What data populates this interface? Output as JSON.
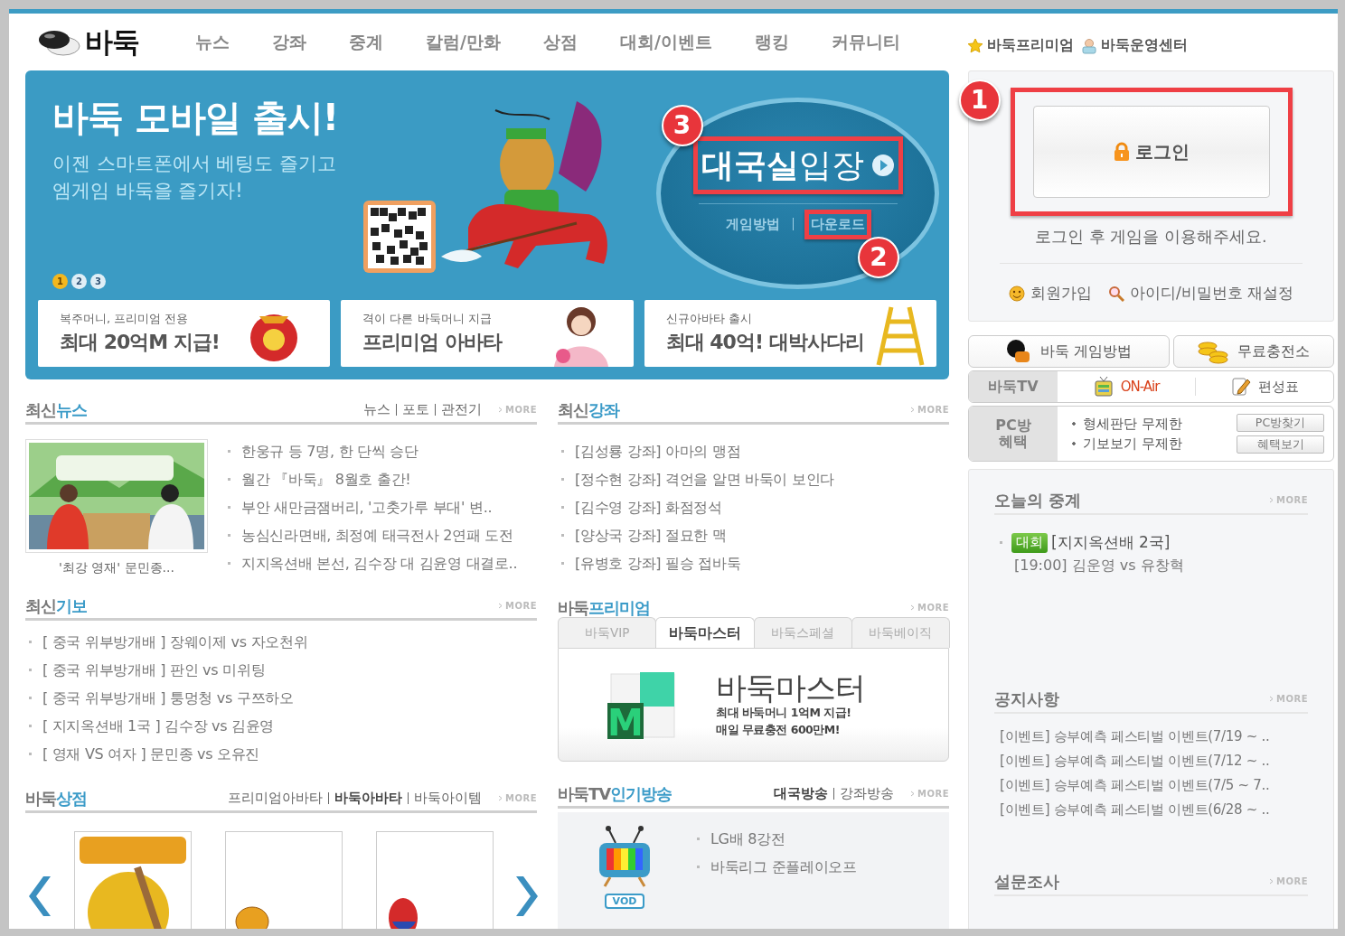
{
  "header": {
    "logo": "바둑",
    "nav": [
      {
        "label": "뉴스"
      },
      {
        "label": "강좌"
      },
      {
        "label": "중계"
      },
      {
        "label": "칼럼/만화"
      },
      {
        "label": "상점"
      },
      {
        "label": "대회/이벤트"
      },
      {
        "label": "랭킹"
      },
      {
        "label": "커뮤니티"
      }
    ],
    "links": [
      {
        "label": "바둑프리미엄"
      },
      {
        "label": "바둑운영센터"
      }
    ]
  },
  "banner": {
    "title": "바둑 모바일 출시!",
    "subtitle": [
      "이젠 스마트폰에서 베팅도 즐기고",
      "엠게임 바둑을 즐기자!"
    ],
    "pager": [
      {
        "label": "1",
        "selected": true
      },
      {
        "label": "2",
        "selected": false
      },
      {
        "label": "3",
        "selected": false
      }
    ],
    "enter": {
      "label": "**대국실**입장",
      "callout": "3"
    },
    "links": [
      {
        "label": "게임방법"
      },
      {
        "label": "다운로드",
        "callout": "2"
      }
    ],
    "promos": [
      {
        "caption": "복주머니, 프리미엄 전용",
        "headline": "최대 20억M 지급!"
      },
      {
        "caption": "격이 다른 바둑머니 지급",
        "headline": "프리미엄 아바타"
      },
      {
        "caption": "신규아바타 출시",
        "headline": "최대 40억! 대박사다리"
      }
    ]
  },
  "news": {
    "heading": {
      "title": "최신",
      "accent": "뉴스"
    },
    "sublinks": [
      {
        "label": "뉴스",
        "selected": false
      },
      {
        "label": "포토",
        "selected": false
      },
      {
        "label": "관전기",
        "selected": false
      }
    ],
    "more": "MORE",
    "photo_caption": "'최강 영재' 문민종...",
    "items": [
      "한웅규 등 7명, 한 단씩 승단",
      "월간 『바둑』 8월호 출간!",
      "부안 새만금잼버리, '고춧가루 부대' 변..",
      "농심신라면배, 최정예 태극전사 2연패 도전",
      "지지옥션배 본선, 김수장 대 김윤영 대결로.."
    ]
  },
  "lectures": {
    "heading": {
      "title": "최신",
      "accent": "강좌"
    },
    "more": "MORE",
    "items": [
      "[김성룡 강좌] 아마의 맹점",
      "[정수현 강좌] 격언을 알면 바둑이 보인다",
      "[김수영 강좌] 화점정석",
      "[양상국 강좌] 절묘한 맥",
      "[유병호 강좌] 필승 접바둑"
    ]
  },
  "records": {
    "heading": {
      "title": "최신",
      "accent": "기보"
    },
    "more": "MORE",
    "items": [
      "[ 중국 위부방개배 ] 장웨이제 vs 자오천위",
      "[ 중국 위부방개배 ] 판인 vs 미위팅",
      "[ 중국 위부방개배 ] 퉁멍청 vs 구쯔하오",
      "[ 지지옥션배 1국 ] 김수장 vs 김윤영",
      "[ 영재 VS 여자 ] 문민종 vs 오유진"
    ]
  },
  "premium": {
    "heading": {
      "title": "바둑",
      "accent": "프리미엄"
    },
    "more": "MORE",
    "tabs": [
      {
        "label": "바둑VIP",
        "selected": false
      },
      {
        "label": "바둑마스터",
        "selected": true
      },
      {
        "label": "바둑스페셜",
        "selected": false
      },
      {
        "label": "바둑베이직",
        "selected": false
      }
    ],
    "logo_letter": "M",
    "title": "바둑마스터",
    "lines": [
      "최대 바둑머니 1억M 지급!",
      "매일 무료충전 600만M!"
    ]
  },
  "shop": {
    "heading": {
      "title": "바둑",
      "accent": "상점"
    },
    "sublinks": [
      {
        "label": "프리미엄아바타",
        "selected": false
      },
      {
        "label": "바둑아바타",
        "selected": true
      },
      {
        "label": "바둑아이템",
        "selected": false
      }
    ],
    "more": "MORE"
  },
  "tv": {
    "heading": {
      "title": "바둑TV",
      "accent": "인기방송"
    },
    "sublinks": [
      {
        "label": "대국방송",
        "selected": true
      },
      {
        "label": "강좌방송",
        "selected": false
      }
    ],
    "more": "MORE",
    "badge": "VOD",
    "items": [
      "LG배 8강전",
      "바둑리그 준플레이오프"
    ]
  },
  "login": {
    "button": "로그인",
    "callout": "1",
    "hint": "로그인 후 게임을 이용해주세요.",
    "links": [
      {
        "label": "회원가입"
      },
      {
        "label": "아이디/비밀번호 재설정"
      }
    ]
  },
  "quick": [
    {
      "label": "바둑 게임방법"
    },
    {
      "label": "무료충전소"
    }
  ],
  "tv_bar": {
    "label": "바둑TV",
    "items": [
      {
        "label": "ON-Air",
        "live": true
      },
      {
        "label": "편성표",
        "live": false
      }
    ]
  },
  "pc_bar": {
    "label": "PC방 혜택",
    "bullets": [
      "형세판단 무제한",
      "기보보기 무제한"
    ],
    "buttons": [
      "PC방찾기",
      "혜택보기"
    ]
  },
  "today": {
    "heading": "오늘의 중계",
    "more": "MORE",
    "items": [
      {
        "tag": "대회",
        "title": "[지지옥션배 2국]",
        "detail": "[19:00] 김운영 vs 유창혁"
      }
    ]
  },
  "notices": {
    "heading": "공지사항",
    "more": "MORE",
    "items": [
      "[이벤트] 승부예측 페스티벌 이벤트(7/19 ~ ..",
      "[이벤트] 승부예측 페스티벌 이벤트(7/12 ~ ..",
      "[이벤트] 승부예측 페스티벌 이벤트(7/5 ~ 7..",
      "[이벤트] 승부예측 페스티벌 이벤트(6/28 ~ .."
    ]
  },
  "survey": {
    "heading": "설문조사",
    "more": "MORE"
  }
}
